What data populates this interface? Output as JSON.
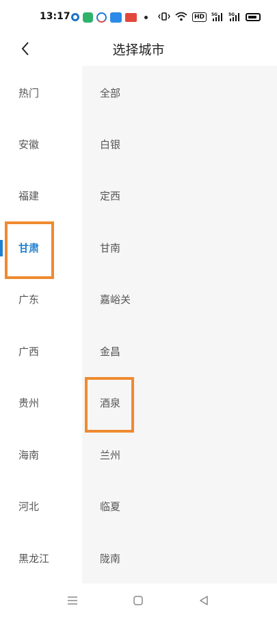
{
  "status_bar": {
    "time": "13:17",
    "notification_icons": [
      "record-icon",
      "phone-icon",
      "face-app-icon",
      "app-badge-icon",
      "toutiao-icon",
      "dot-icon"
    ],
    "system_icons": [
      "vibrate-icon",
      "wifi-icon",
      "hd-icon",
      "signal-5g-icon",
      "signal-5g-icon",
      "battery-icon"
    ],
    "hd_label": "HD"
  },
  "header": {
    "title": "选择城市",
    "back_icon": "chevron-left-icon"
  },
  "provinces": [
    {
      "label": "热门"
    },
    {
      "label": "安徽"
    },
    {
      "label": "福建"
    },
    {
      "label": "甘肃"
    },
    {
      "label": "广东"
    },
    {
      "label": "广西"
    },
    {
      "label": "贵州"
    },
    {
      "label": "海南"
    },
    {
      "label": "河北"
    },
    {
      "label": "黑龙江"
    }
  ],
  "selected_province": "甘肃",
  "cities": [
    {
      "label": "全部"
    },
    {
      "label": "白银"
    },
    {
      "label": "定西"
    },
    {
      "label": "甘南"
    },
    {
      "label": "嘉峪关"
    },
    {
      "label": "金昌"
    },
    {
      "label": "酒泉"
    },
    {
      "label": "兰州"
    },
    {
      "label": "临夏"
    },
    {
      "label": "陇南"
    }
  ],
  "highlights": [
    "甘肃",
    "酒泉"
  ],
  "colors": {
    "accent": "#1f7fd0",
    "highlight_box": "#ef8a2f",
    "city_panel_bg": "#f6f6f6"
  },
  "nav_bar": {
    "icons": [
      "menu-icon",
      "home-square-icon",
      "back-triangle-icon"
    ]
  }
}
